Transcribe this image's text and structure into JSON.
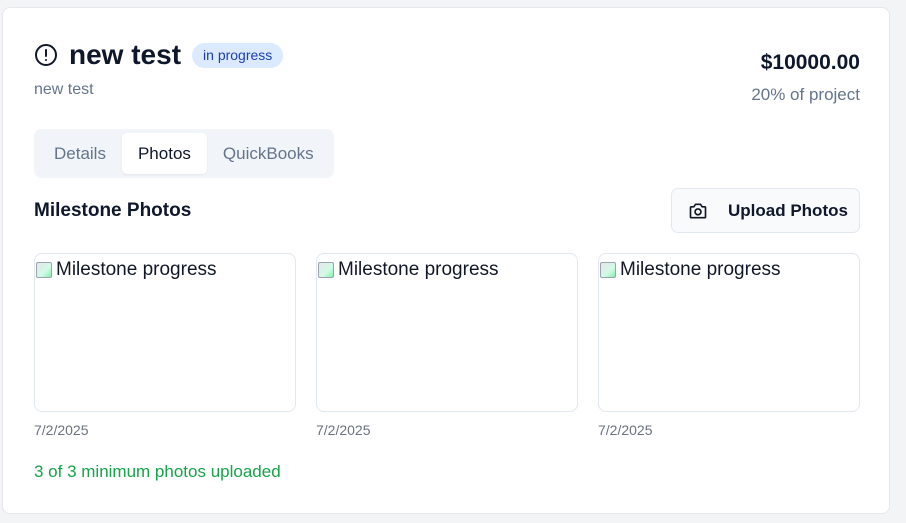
{
  "milestone": {
    "title": "new test",
    "status": "in progress",
    "description": "new test",
    "amount": "$10000.00",
    "percent_label": "20% of project"
  },
  "tabs": [
    {
      "label": "Details"
    },
    {
      "label": "Photos"
    },
    {
      "label": "QuickBooks"
    }
  ],
  "photos_section": {
    "title": "Milestone Photos",
    "upload_label": "Upload Photos",
    "items": [
      {
        "alt": "Milestone progress",
        "date": "7/2/2025"
      },
      {
        "alt": "Milestone progress",
        "date": "7/2/2025"
      },
      {
        "alt": "Milestone progress",
        "date": "7/2/2025"
      }
    ],
    "status_note": "3 of 3 minimum photos uploaded"
  },
  "icons": {
    "status": "alert-circle-icon",
    "upload": "camera-icon"
  },
  "colors": {
    "badge_bg": "#dbeafe",
    "badge_text": "#1e40af",
    "success": "#16a34a",
    "muted": "#64748b"
  }
}
